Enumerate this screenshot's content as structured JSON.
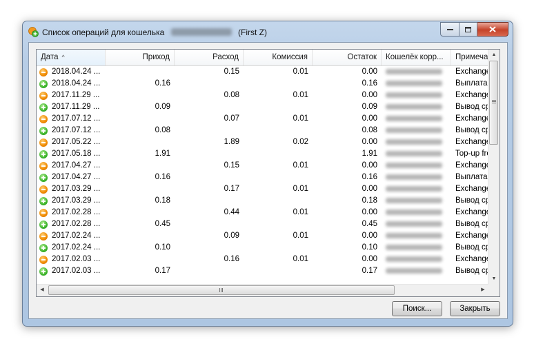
{
  "window": {
    "title_prefix": "Список операций для кошелька",
    "title_suffix": "(First Z)"
  },
  "table": {
    "columns": [
      "Дата",
      "Приход",
      "Расход",
      "Комиссия",
      "Остаток",
      "Кошелёк корр...",
      "Примечан"
    ],
    "sort_indicator": "^",
    "rows": [
      {
        "type": "out",
        "date": "2018.04.24 ...",
        "income": "",
        "expense": "0.15",
        "commission": "0.01",
        "balance": "0.00",
        "note": "Exchange"
      },
      {
        "type": "in",
        "date": "2018.04.24 ...",
        "income": "0.16",
        "expense": "",
        "commission": "",
        "balance": "0.16",
        "note": "Выплата г"
      },
      {
        "type": "out",
        "date": "2017.11.29 ...",
        "income": "",
        "expense": "0.08",
        "commission": "0.01",
        "balance": "0.00",
        "note": "Exchange"
      },
      {
        "type": "in",
        "date": "2017.11.29 ...",
        "income": "0.09",
        "expense": "",
        "commission": "",
        "balance": "0.09",
        "note": "Вывод сре"
      },
      {
        "type": "out",
        "date": "2017.07.12 ...",
        "income": "",
        "expense": "0.07",
        "commission": "0.01",
        "balance": "0.00",
        "note": "Exchange"
      },
      {
        "type": "in",
        "date": "2017.07.12 ...",
        "income": "0.08",
        "expense": "",
        "commission": "",
        "balance": "0.08",
        "note": "Вывод сре"
      },
      {
        "type": "out",
        "date": "2017.05.22 ...",
        "income": "",
        "expense": "1.89",
        "commission": "0.02",
        "balance": "0.00",
        "note": "Exchange"
      },
      {
        "type": "in",
        "date": "2017.05.18 ...",
        "income": "1.91",
        "expense": "",
        "commission": "",
        "balance": "1.91",
        "note": "Top-up fro"
      },
      {
        "type": "out",
        "date": "2017.04.27 ...",
        "income": "",
        "expense": "0.15",
        "commission": "0.01",
        "balance": "0.00",
        "note": "Exchange"
      },
      {
        "type": "in",
        "date": "2017.04.27 ...",
        "income": "0.16",
        "expense": "",
        "commission": "",
        "balance": "0.16",
        "note": "Выплата г"
      },
      {
        "type": "out",
        "date": "2017.03.29 ...",
        "income": "",
        "expense": "0.17",
        "commission": "0.01",
        "balance": "0.00",
        "note": "Exchange"
      },
      {
        "type": "in",
        "date": "2017.03.29 ...",
        "income": "0.18",
        "expense": "",
        "commission": "",
        "balance": "0.18",
        "note": "Вывод сре"
      },
      {
        "type": "out",
        "date": "2017.02.28 ...",
        "income": "",
        "expense": "0.44",
        "commission": "0.01",
        "balance": "0.00",
        "note": "Exchange"
      },
      {
        "type": "in",
        "date": "2017.02.28 ...",
        "income": "0.45",
        "expense": "",
        "commission": "",
        "balance": "0.45",
        "note": "Вывод сре"
      },
      {
        "type": "out",
        "date": "2017.02.24 ...",
        "income": "",
        "expense": "0.09",
        "commission": "0.01",
        "balance": "0.00",
        "note": "Exchange"
      },
      {
        "type": "in",
        "date": "2017.02.24 ...",
        "income": "0.10",
        "expense": "",
        "commission": "",
        "balance": "0.10",
        "note": "Вывод сре"
      },
      {
        "type": "out",
        "date": "2017.02.03 ...",
        "income": "",
        "expense": "0.16",
        "commission": "0.01",
        "balance": "0.00",
        "note": "Exchange"
      },
      {
        "type": "in",
        "date": "2017.02.03 ...",
        "income": "0.17",
        "expense": "",
        "commission": "",
        "balance": "0.17",
        "note": "Вывод сре"
      }
    ]
  },
  "buttons": {
    "search": "Поиск...",
    "close": "Закрыть"
  },
  "colors": {
    "expense_icon": "#f08a00",
    "income_icon": "#3db52b",
    "window_frame": "#b7cde6"
  },
  "icons": {
    "app": "wallet-app-icon",
    "expense": "minus-circle-icon",
    "income": "plus-circle-icon"
  }
}
